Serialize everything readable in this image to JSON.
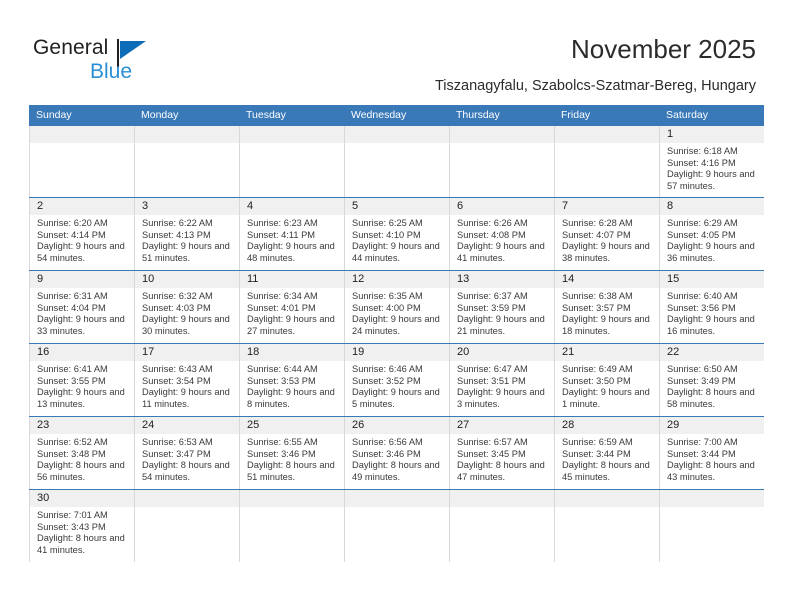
{
  "brand": {
    "name_part1": "General",
    "name_part2": "Blue",
    "logo_icon": "triangle-logo-icon",
    "colors": {
      "dark": "#231f20",
      "blue": "#2a8fd4",
      "triangle": "#0d6cb8"
    }
  },
  "header": {
    "title": "November 2025",
    "subtitle": "Tiszanagyfalu, Szabolcs-Szatmar-Bereg, Hungary"
  },
  "calendar": {
    "accent_color": "#3a79b8",
    "daynum_strip_color": "#f0f0f0",
    "weekday_headers": [
      "Sunday",
      "Monday",
      "Tuesday",
      "Wednesday",
      "Thursday",
      "Friday",
      "Saturday"
    ],
    "weeks": [
      [
        {
          "day": ""
        },
        {
          "day": ""
        },
        {
          "day": ""
        },
        {
          "day": ""
        },
        {
          "day": ""
        },
        {
          "day": ""
        },
        {
          "day": "1",
          "sunrise": "Sunrise: 6:18 AM",
          "sunset": "Sunset: 4:16 PM",
          "daylight": "Daylight: 9 hours and 57 minutes."
        }
      ],
      [
        {
          "day": "2",
          "sunrise": "Sunrise: 6:20 AM",
          "sunset": "Sunset: 4:14 PM",
          "daylight": "Daylight: 9 hours and 54 minutes."
        },
        {
          "day": "3",
          "sunrise": "Sunrise: 6:22 AM",
          "sunset": "Sunset: 4:13 PM",
          "daylight": "Daylight: 9 hours and 51 minutes."
        },
        {
          "day": "4",
          "sunrise": "Sunrise: 6:23 AM",
          "sunset": "Sunset: 4:11 PM",
          "daylight": "Daylight: 9 hours and 48 minutes."
        },
        {
          "day": "5",
          "sunrise": "Sunrise: 6:25 AM",
          "sunset": "Sunset: 4:10 PM",
          "daylight": "Daylight: 9 hours and 44 minutes."
        },
        {
          "day": "6",
          "sunrise": "Sunrise: 6:26 AM",
          "sunset": "Sunset: 4:08 PM",
          "daylight": "Daylight: 9 hours and 41 minutes."
        },
        {
          "day": "7",
          "sunrise": "Sunrise: 6:28 AM",
          "sunset": "Sunset: 4:07 PM",
          "daylight": "Daylight: 9 hours and 38 minutes."
        },
        {
          "day": "8",
          "sunrise": "Sunrise: 6:29 AM",
          "sunset": "Sunset: 4:05 PM",
          "daylight": "Daylight: 9 hours and 36 minutes."
        }
      ],
      [
        {
          "day": "9",
          "sunrise": "Sunrise: 6:31 AM",
          "sunset": "Sunset: 4:04 PM",
          "daylight": "Daylight: 9 hours and 33 minutes."
        },
        {
          "day": "10",
          "sunrise": "Sunrise: 6:32 AM",
          "sunset": "Sunset: 4:03 PM",
          "daylight": "Daylight: 9 hours and 30 minutes."
        },
        {
          "day": "11",
          "sunrise": "Sunrise: 6:34 AM",
          "sunset": "Sunset: 4:01 PM",
          "daylight": "Daylight: 9 hours and 27 minutes."
        },
        {
          "day": "12",
          "sunrise": "Sunrise: 6:35 AM",
          "sunset": "Sunset: 4:00 PM",
          "daylight": "Daylight: 9 hours and 24 minutes."
        },
        {
          "day": "13",
          "sunrise": "Sunrise: 6:37 AM",
          "sunset": "Sunset: 3:59 PM",
          "daylight": "Daylight: 9 hours and 21 minutes."
        },
        {
          "day": "14",
          "sunrise": "Sunrise: 6:38 AM",
          "sunset": "Sunset: 3:57 PM",
          "daylight": "Daylight: 9 hours and 18 minutes."
        },
        {
          "day": "15",
          "sunrise": "Sunrise: 6:40 AM",
          "sunset": "Sunset: 3:56 PM",
          "daylight": "Daylight: 9 hours and 16 minutes."
        }
      ],
      [
        {
          "day": "16",
          "sunrise": "Sunrise: 6:41 AM",
          "sunset": "Sunset: 3:55 PM",
          "daylight": "Daylight: 9 hours and 13 minutes."
        },
        {
          "day": "17",
          "sunrise": "Sunrise: 6:43 AM",
          "sunset": "Sunset: 3:54 PM",
          "daylight": "Daylight: 9 hours and 11 minutes."
        },
        {
          "day": "18",
          "sunrise": "Sunrise: 6:44 AM",
          "sunset": "Sunset: 3:53 PM",
          "daylight": "Daylight: 9 hours and 8 minutes."
        },
        {
          "day": "19",
          "sunrise": "Sunrise: 6:46 AM",
          "sunset": "Sunset: 3:52 PM",
          "daylight": "Daylight: 9 hours and 5 minutes."
        },
        {
          "day": "20",
          "sunrise": "Sunrise: 6:47 AM",
          "sunset": "Sunset: 3:51 PM",
          "daylight": "Daylight: 9 hours and 3 minutes."
        },
        {
          "day": "21",
          "sunrise": "Sunrise: 6:49 AM",
          "sunset": "Sunset: 3:50 PM",
          "daylight": "Daylight: 9 hours and 1 minute."
        },
        {
          "day": "22",
          "sunrise": "Sunrise: 6:50 AM",
          "sunset": "Sunset: 3:49 PM",
          "daylight": "Daylight: 8 hours and 58 minutes."
        }
      ],
      [
        {
          "day": "23",
          "sunrise": "Sunrise: 6:52 AM",
          "sunset": "Sunset: 3:48 PM",
          "daylight": "Daylight: 8 hours and 56 minutes."
        },
        {
          "day": "24",
          "sunrise": "Sunrise: 6:53 AM",
          "sunset": "Sunset: 3:47 PM",
          "daylight": "Daylight: 8 hours and 54 minutes."
        },
        {
          "day": "25",
          "sunrise": "Sunrise: 6:55 AM",
          "sunset": "Sunset: 3:46 PM",
          "daylight": "Daylight: 8 hours and 51 minutes."
        },
        {
          "day": "26",
          "sunrise": "Sunrise: 6:56 AM",
          "sunset": "Sunset: 3:46 PM",
          "daylight": "Daylight: 8 hours and 49 minutes."
        },
        {
          "day": "27",
          "sunrise": "Sunrise: 6:57 AM",
          "sunset": "Sunset: 3:45 PM",
          "daylight": "Daylight: 8 hours and 47 minutes."
        },
        {
          "day": "28",
          "sunrise": "Sunrise: 6:59 AM",
          "sunset": "Sunset: 3:44 PM",
          "daylight": "Daylight: 8 hours and 45 minutes."
        },
        {
          "day": "29",
          "sunrise": "Sunrise: 7:00 AM",
          "sunset": "Sunset: 3:44 PM",
          "daylight": "Daylight: 8 hours and 43 minutes."
        }
      ],
      [
        {
          "day": "30",
          "sunrise": "Sunrise: 7:01 AM",
          "sunset": "Sunset: 3:43 PM",
          "daylight": "Daylight: 8 hours and 41 minutes."
        },
        {
          "day": ""
        },
        {
          "day": ""
        },
        {
          "day": ""
        },
        {
          "day": ""
        },
        {
          "day": ""
        },
        {
          "day": ""
        }
      ]
    ]
  }
}
